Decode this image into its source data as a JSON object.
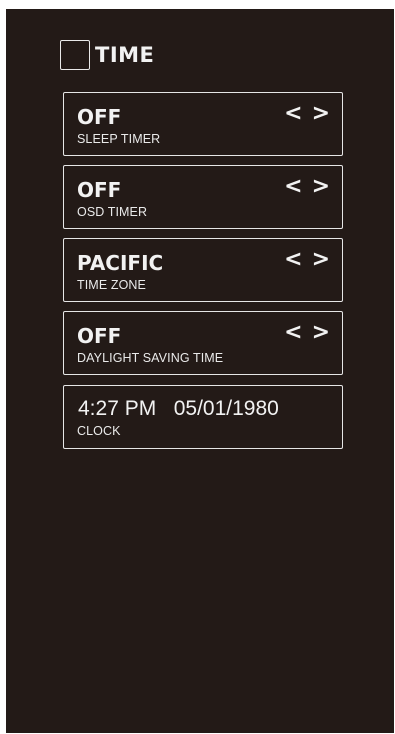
{
  "header": {
    "title": "TIME",
    "icon": "empty-square-icon"
  },
  "colors": {
    "background": "#231a17",
    "text": "#f2f2f2",
    "border": "#e6e6e6"
  },
  "settings": [
    {
      "value": "OFF",
      "label": "SLEEP TIMER",
      "prev": "<",
      "next": ">"
    },
    {
      "value": "OFF",
      "label": "OSD TIMER",
      "prev": "<",
      "next": ">"
    },
    {
      "value": "PACIFIC",
      "label": "TIME ZONE",
      "prev": "<",
      "next": ">"
    },
    {
      "value": "OFF",
      "label": "DAYLIGHT SAVING TIME",
      "prev": "<",
      "next": ">"
    }
  ],
  "clock": {
    "time": "4:27 PM",
    "date": "05/01/1980",
    "label": "CLOCK"
  }
}
